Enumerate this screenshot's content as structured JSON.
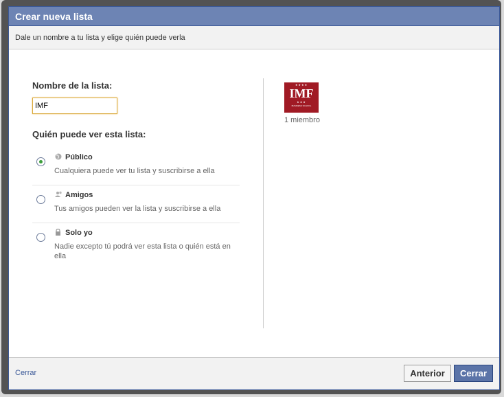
{
  "dialog": {
    "title": "Crear nueva lista",
    "subtitle": "Dale un nombre a tu lista y elige quién puede verla"
  },
  "form": {
    "name_label": "Nombre de la lista:",
    "name_value": "IMF",
    "visibility_label": "Quién puede ver esta lista:",
    "options": [
      {
        "title": "Público",
        "desc": "Cualquiera puede ver tu lista y suscribirse a ella",
        "icon": "globe-icon",
        "checked": true
      },
      {
        "title": "Amigos",
        "desc": "Tus amigos pueden ver la lista y suscribirse a ella",
        "icon": "friends-icon",
        "checked": false
      },
      {
        "title": "Solo yo",
        "desc": "Nadie excepto tú podrá ver esta lista o quién está en ella",
        "icon": "lock-icon",
        "checked": false
      }
    ]
  },
  "members": {
    "logo_text": "IMF",
    "logo_stars": "★★★★",
    "logo_stars_bottom": "★★★",
    "logo_tagline": "BUSINESS SCHOOL",
    "count_label": "1 miembro"
  },
  "footer": {
    "cancel_link": "Cerrar",
    "prev_button": "Anterior",
    "close_button": "Cerrar"
  },
  "colors": {
    "header": "#6d84b4",
    "accent": "#3b5998",
    "logo_bg": "#a01a24"
  }
}
